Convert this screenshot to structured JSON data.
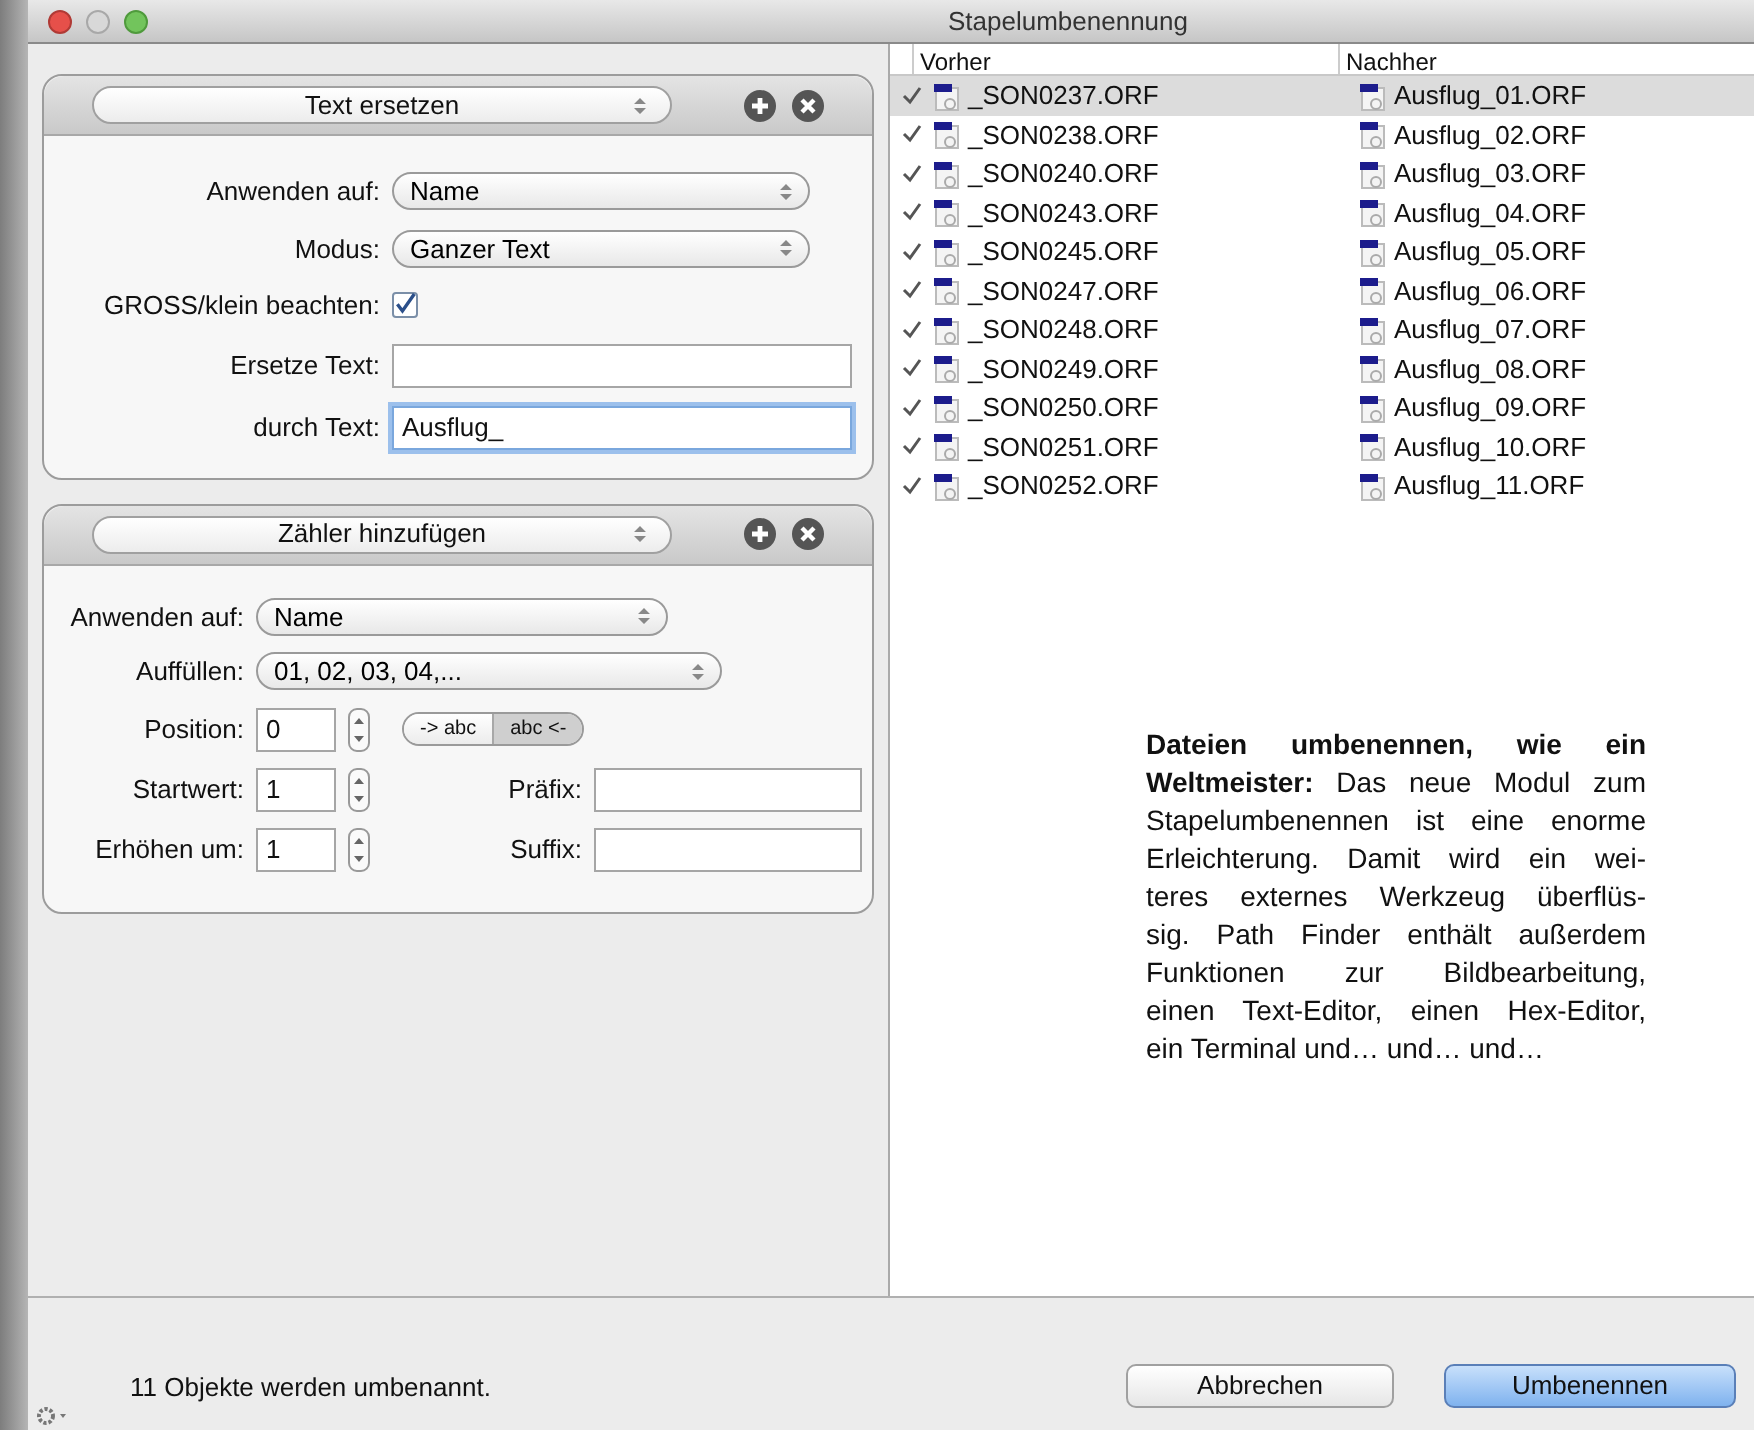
{
  "window": {
    "title": "Stapelumbenennung"
  },
  "actions": [
    {
      "kind": "replace",
      "title": "Text ersetzen",
      "fields": [
        {
          "kind": "select",
          "label": "Anwenden auf:",
          "value": "Name"
        },
        {
          "kind": "select",
          "label": "Modus:",
          "value": "Ganzer Text"
        },
        {
          "kind": "checkbox",
          "label": "GROSS/klein beachten:",
          "checked": true
        },
        {
          "kind": "text",
          "label": "Ersetze Text:"
        },
        {
          "kind": "text",
          "label": "durch Text:",
          "value": "Ausflug_",
          "focused": true
        }
      ]
    },
    {
      "kind": "counter",
      "title": "Zähler hinzufügen",
      "apply": {
        "label": "Anwenden auf:",
        "value": "Name"
      },
      "padding": {
        "label": "Auffüllen:",
        "value": "01, 02, 03, 04,..."
      },
      "position": {
        "label": "Position:",
        "value": "0",
        "segments": [
          {
            "label": "-> abc",
            "selected": false
          },
          {
            "label": "abc <-",
            "selected": true
          }
        ]
      },
      "start": {
        "label": "Startwert:",
        "value": "1"
      },
      "step": {
        "label": "Erhöhen um:",
        "value": "1"
      },
      "prefix": {
        "label": "Präfix:"
      },
      "suffix": {
        "label": "Suffix:"
      }
    }
  ],
  "table": {
    "columns": [
      "Vorher",
      "Nachher"
    ],
    "rows": [
      {
        "before": "_SON0237.ORF",
        "after": "Ausflug_01.ORF",
        "checked": true,
        "selected": true
      },
      {
        "before": "_SON0238.ORF",
        "after": "Ausflug_02.ORF",
        "checked": true,
        "selected": false
      },
      {
        "before": "_SON0240.ORF",
        "after": "Ausflug_03.ORF",
        "checked": true,
        "selected": false
      },
      {
        "before": "_SON0243.ORF",
        "after": "Ausflug_04.ORF",
        "checked": true,
        "selected": false
      },
      {
        "before": "_SON0245.ORF",
        "after": "Ausflug_05.ORF",
        "checked": true,
        "selected": false
      },
      {
        "before": "_SON0247.ORF",
        "after": "Ausflug_06.ORF",
        "checked": true,
        "selected": false
      },
      {
        "before": "_SON0248.ORF",
        "after": "Ausflug_07.ORF",
        "checked": true,
        "selected": false
      },
      {
        "before": "_SON0249.ORF",
        "after": "Ausflug_08.ORF",
        "checked": true,
        "selected": false
      },
      {
        "before": "_SON0250.ORF",
        "after": "Ausflug_09.ORF",
        "checked": true,
        "selected": false
      },
      {
        "before": "_SON0251.ORF",
        "after": "Ausflug_10.ORF",
        "checked": true,
        "selected": false
      },
      {
        "before": "_SON0252.ORF",
        "after": "Ausflug_11.ORF",
        "checked": true,
        "selected": false
      }
    ]
  },
  "caption": {
    "lines": [
      "**Dateien umbenennen, wie ein**",
      "**Weltmeister:** Das neue Modul zum",
      "Stapelumbenennen ist eine enorme",
      "Erleichterung. Damit wird ein wei-",
      "teres externes Werkzeug überflüs-",
      "sig. Path Finder enthält außerdem",
      "Funktionen zur Bildbearbeitung,",
      "einen Text-Editor, einen Hex-Editor,",
      "ein Terminal und… und… und…"
    ]
  },
  "status": "11 Objekte werden umbenannt.",
  "buttons": [
    {
      "label": "Abbrechen",
      "default": false
    },
    {
      "label": "Umbenennen",
      "default": true
    }
  ]
}
